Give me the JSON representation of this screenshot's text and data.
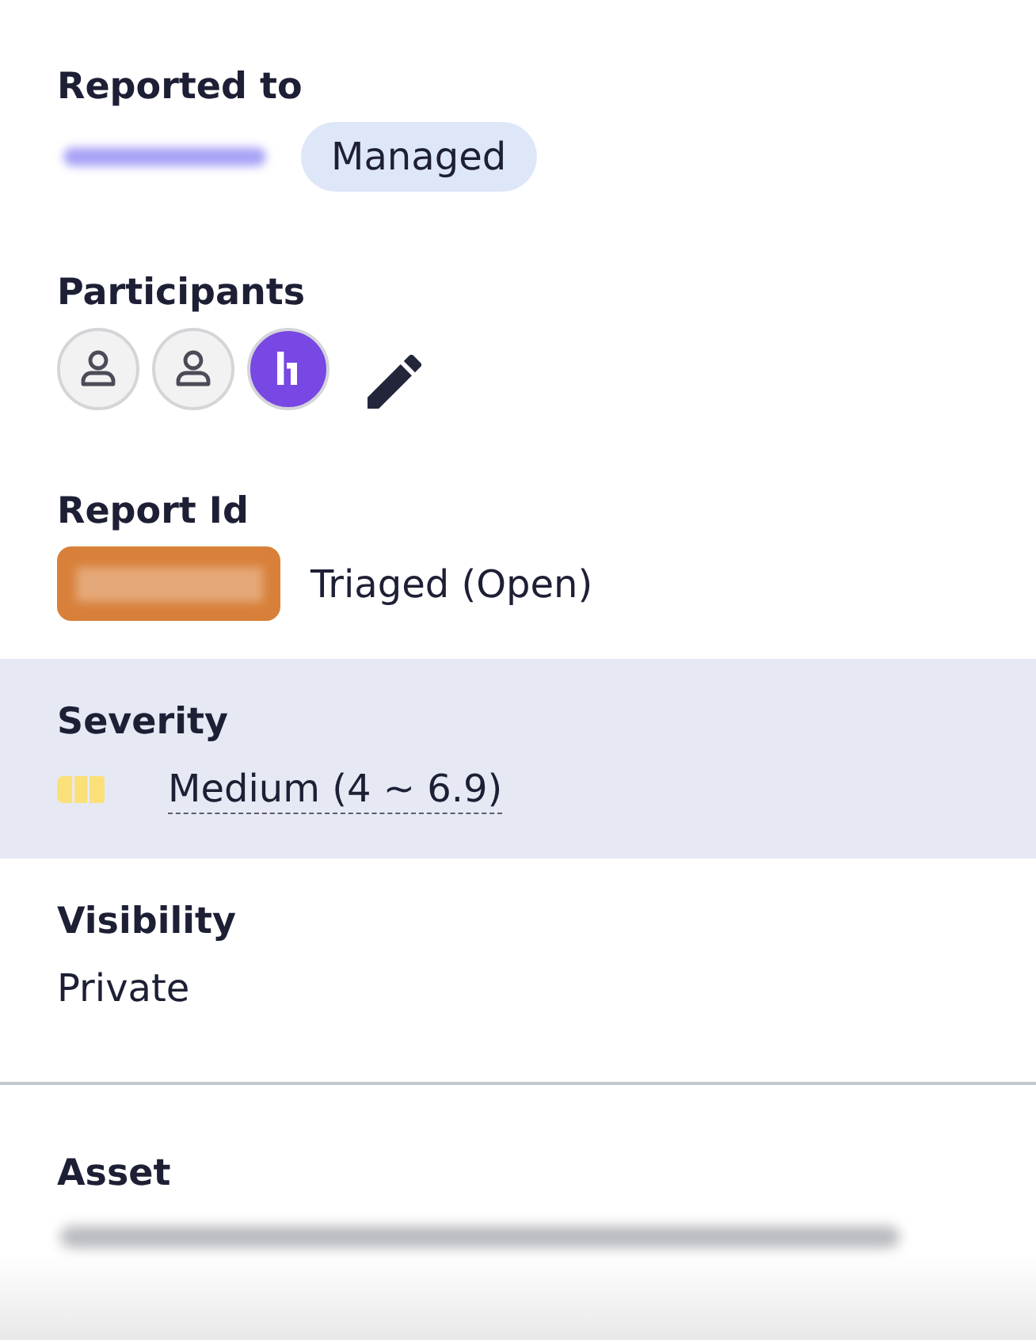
{
  "fields": [
    {
      "kind": "reported_to",
      "label": "Reported to",
      "badge": "Managed",
      "highlighted": false
    },
    {
      "kind": "participants",
      "label": "Participants",
      "avatars": [
        {
          "kind": "user"
        },
        {
          "kind": "user"
        },
        {
          "kind": "team"
        }
      ],
      "highlighted": false
    },
    {
      "kind": "report_id",
      "label": "Report Id",
      "status": "Triaged (Open)",
      "highlighted": false
    },
    {
      "kind": "severity",
      "label": "Severity",
      "value": "Medium (4 ~ 6.9)",
      "highlighted": true
    },
    {
      "kind": "text",
      "label": "Visibility",
      "value": "Private",
      "highlighted": false
    }
  ],
  "asset": {
    "label": "Asset"
  }
}
